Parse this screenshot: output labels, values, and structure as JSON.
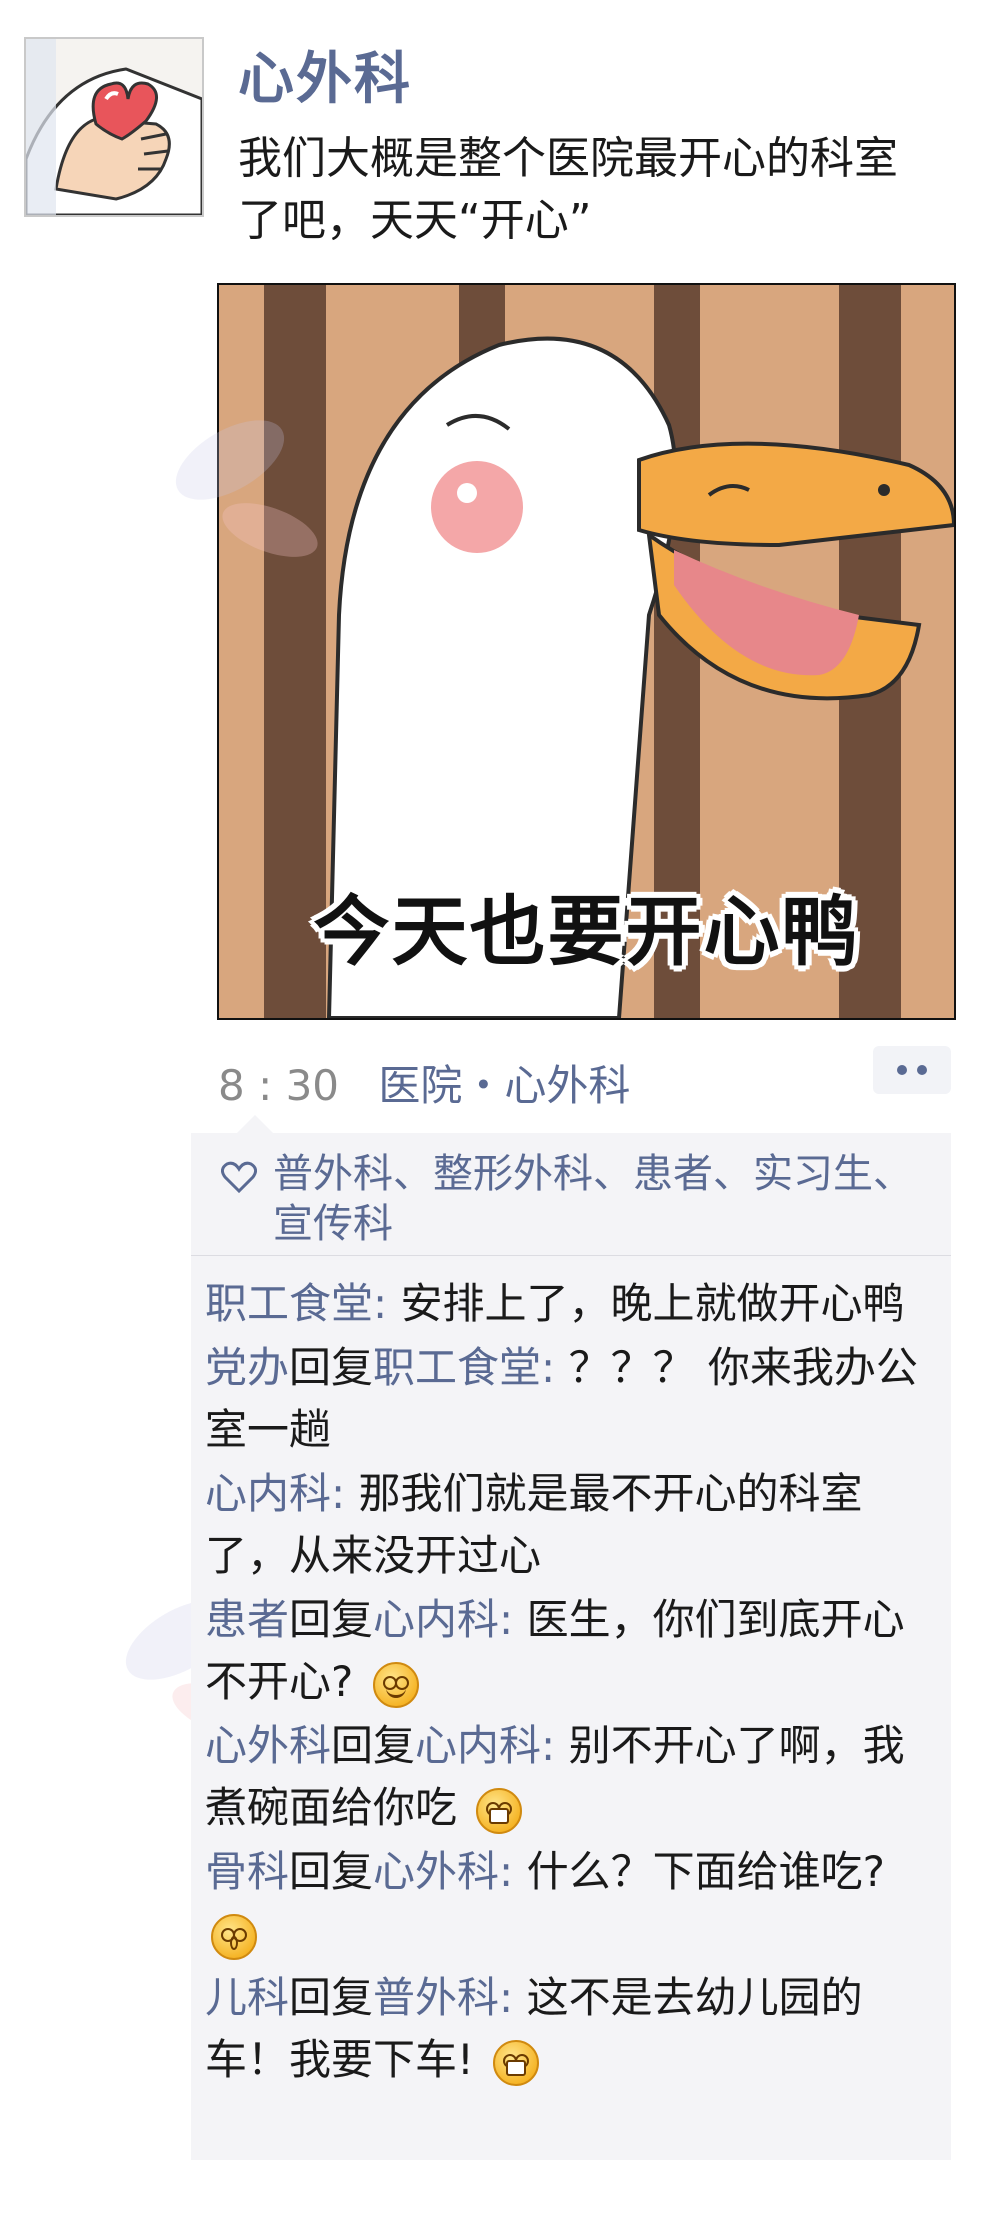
{
  "post": {
    "author": "心外科",
    "text": "我们大概是整个医院最开心的科室了吧，天天“开心”",
    "image_caption": "今天也要开心鸭",
    "time": "8 : 30",
    "location": "医院・心外科"
  },
  "likes": {
    "names": "普外科、整形外科、患者、实习生、宣传科"
  },
  "comments": [
    {
      "user": "职工食堂",
      "reply_to": "",
      "text": "安排上了，晚上就做开心鸭",
      "emoji": ""
    },
    {
      "user": "党办",
      "reply_word": "回复",
      "reply_to": "职工食堂",
      "text": "？？？ 你来我办公室一趟",
      "emoji": ""
    },
    {
      "user": "心内科",
      "reply_to": "",
      "text": "那我们就是最不开心的科室了，从来没开过心",
      "emoji": ""
    },
    {
      "user": "患者",
      "reply_word": "回复",
      "reply_to": "心内科",
      "text": "医生，你们到底开心不开心?",
      "emoji": "dizzy-emoji"
    },
    {
      "user": "心外科",
      "reply_word": "回复",
      "reply_to": "心内科",
      "text": "别不开心了啊，我煮碗面给你吃",
      "emoji": "grin-emoji"
    },
    {
      "user": "骨科",
      "reply_word": "回复",
      "reply_to": "心外科",
      "text": "什么？下面给谁吃?",
      "emoji": "shocked-emoji"
    },
    {
      "user": "儿科",
      "reply_word": "回复",
      "reply_to": "普外科",
      "text": "这不是去幼儿园的车！我要下车!",
      "emoji": "angry-emoji"
    }
  ],
  "colors": {
    "link": "#5a6a93",
    "comment_bg": "#f4f4f7"
  },
  "icons": {
    "like": "heart-outline-icon",
    "more": "more-dots-icon"
  }
}
